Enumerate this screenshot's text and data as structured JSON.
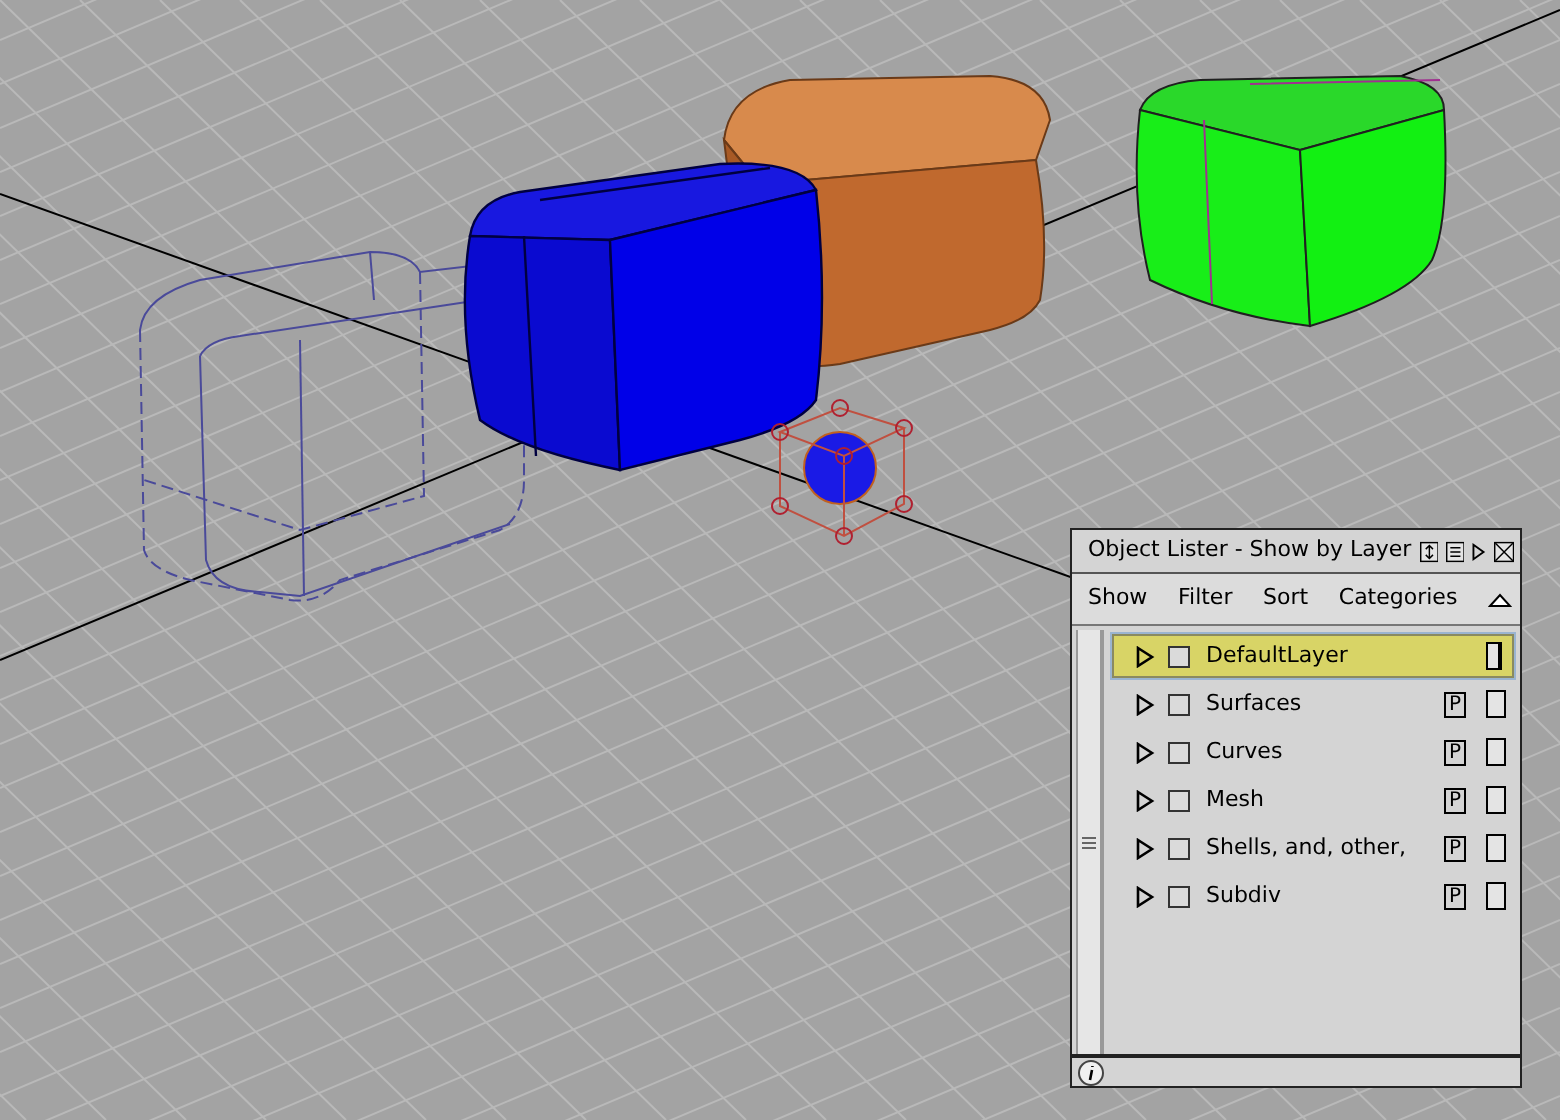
{
  "panel": {
    "title": "Object Lister - Show by Layer",
    "menus": [
      "Show",
      "Filter",
      "Sort",
      "Categories"
    ],
    "layers": [
      {
        "name": "DefaultLayer",
        "selected": true,
        "expanded": false,
        "visible": false
      },
      {
        "name": "Surfaces",
        "selected": false,
        "expanded": false,
        "visible": false,
        "badge": "P"
      },
      {
        "name": "Curves",
        "selected": false,
        "expanded": false,
        "visible": false,
        "badge": "P"
      },
      {
        "name": "Mesh",
        "selected": false,
        "expanded": false,
        "visible": false,
        "badge": "P"
      },
      {
        "name": "Shells, and, other,",
        "selected": false,
        "expanded": false,
        "visible": false,
        "badge": "P"
      },
      {
        "name": "Subdiv",
        "selected": false,
        "expanded": false,
        "visible": false,
        "badge": "P"
      }
    ]
  }
}
